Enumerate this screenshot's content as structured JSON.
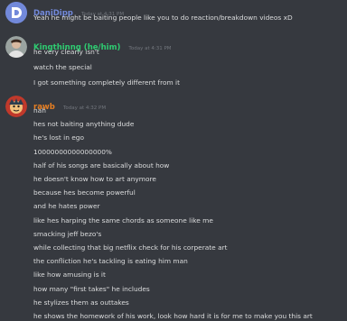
{
  "messages": [
    {
      "username": "DaniDipp",
      "username_color": "#7289da",
      "timestamp": "Today at 4:31 PM",
      "avatar_icon": "discord-logo-avatar",
      "lines": [
        "Yeah he might be baiting people like you to do reaction/breakdown videos xD"
      ]
    },
    {
      "username": "Kingthinng (he/him)",
      "username_color": "#2ecc71",
      "timestamp": "Today at 4:31 PM",
      "avatar_icon": "profile-photo-avatar",
      "lines": [
        "he very clearly isn't",
        "watch the special",
        "I got something completely different from it"
      ]
    },
    {
      "username": "rawb",
      "username_color": "#e67e22",
      "timestamp": "Today at 4:32 PM",
      "avatar_icon": "cartoon-avatar",
      "lines": [
        "nah",
        "hes not baiting anything dude",
        "he's lost in ego",
        "10000000000000000%",
        "half of his songs are basically about how",
        "he doesn't know how to art anymore",
        "because hes become powerful",
        "and he hates power",
        "like hes harping the same chords as someone like me",
        "smacking jeff bezo's",
        "while collecting that big netflix check for his corperate art",
        "the confliction he's tackling is eating him man",
        "like how amusing is it",
        "how many \"first takes\" he includes",
        "he stylizes them as outtakes",
        "he shows the homework of his work, look how hard it is for me to make you this art"
      ]
    }
  ]
}
